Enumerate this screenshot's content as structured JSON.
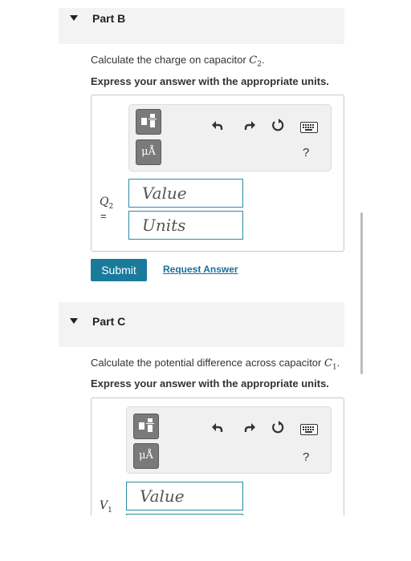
{
  "part_b": {
    "header": "Part B",
    "prompt_text": "Calculate the charge on capacitor ",
    "prompt_var": "C",
    "prompt_sub": "2",
    "prompt_end": ".",
    "instruction": "Express your answer with the appropriate units.",
    "toolbar": {
      "units_glyph": "μÅ",
      "help": "?",
      "icons": [
        "templates-icon",
        "units-icon",
        "undo-icon",
        "redo-icon",
        "reset-icon",
        "keyboard-icon",
        "help-icon"
      ]
    },
    "var_name": "Q",
    "var_sub": "2",
    "equals": "=",
    "value_placeholder": "Value",
    "units_placeholder": "Units",
    "submit_label": "Submit",
    "request_label": "Request Answer"
  },
  "part_c": {
    "header": "Part C",
    "prompt_text": "Calculate the potential difference across capacitor ",
    "prompt_var": "C",
    "prompt_sub": "1",
    "prompt_end": ".",
    "instruction": "Express your answer with the appropriate units.",
    "toolbar": {
      "units_glyph": "μÅ",
      "help": "?"
    },
    "var_name": "V",
    "var_sub": "1",
    "value_placeholder": "Value"
  },
  "colors": {
    "accent": "#1a7a9c",
    "link": "#1a6f9a",
    "field_border": "#2a8ca6",
    "header_bg": "#f3f3f3"
  }
}
